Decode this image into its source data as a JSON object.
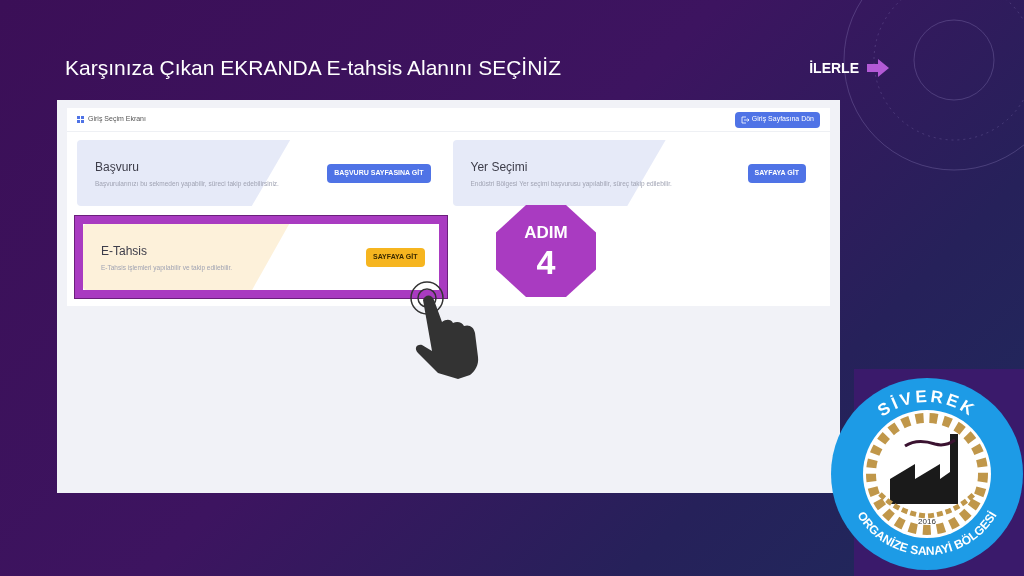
{
  "slide": {
    "title": "Karşınıza Çıkan EKRANDA E-tahsis Alanını SEÇİNİZ",
    "next_label": "İLERLE"
  },
  "app": {
    "header_title": "Giriş Seçim Ekranı",
    "back_button": "Giriş Sayfasına Dön",
    "cards": [
      {
        "title": "Başvuru",
        "description": "Başvurularınızı bu sekmeden yapabilir, süreci takip edebilirsiniz.",
        "button": "BAŞVURU SAYFASINA GİT",
        "kind": "primary",
        "highlighted": false
      },
      {
        "title": "Yer Seçimi",
        "description": "Endüstri Bölgesi Yer seçimi başvurusu yapılabilir, süreç takip edilebilir.",
        "button": "SAYFAYA GİT",
        "kind": "primary",
        "highlighted": false
      },
      {
        "title": "E-Tahsis",
        "description": "E-Tahsis işlemleri yapılabilir ve takip edilebilir.",
        "button": "SAYFAYA GİT",
        "kind": "warning",
        "highlighted": true
      }
    ]
  },
  "step_badge": {
    "label": "ADIM",
    "number": "4"
  },
  "logo": {
    "top_text": "SİVEREK",
    "bottom_text": "ORGANİZE SANAYİ BÖLGESİ",
    "year": "2016"
  }
}
